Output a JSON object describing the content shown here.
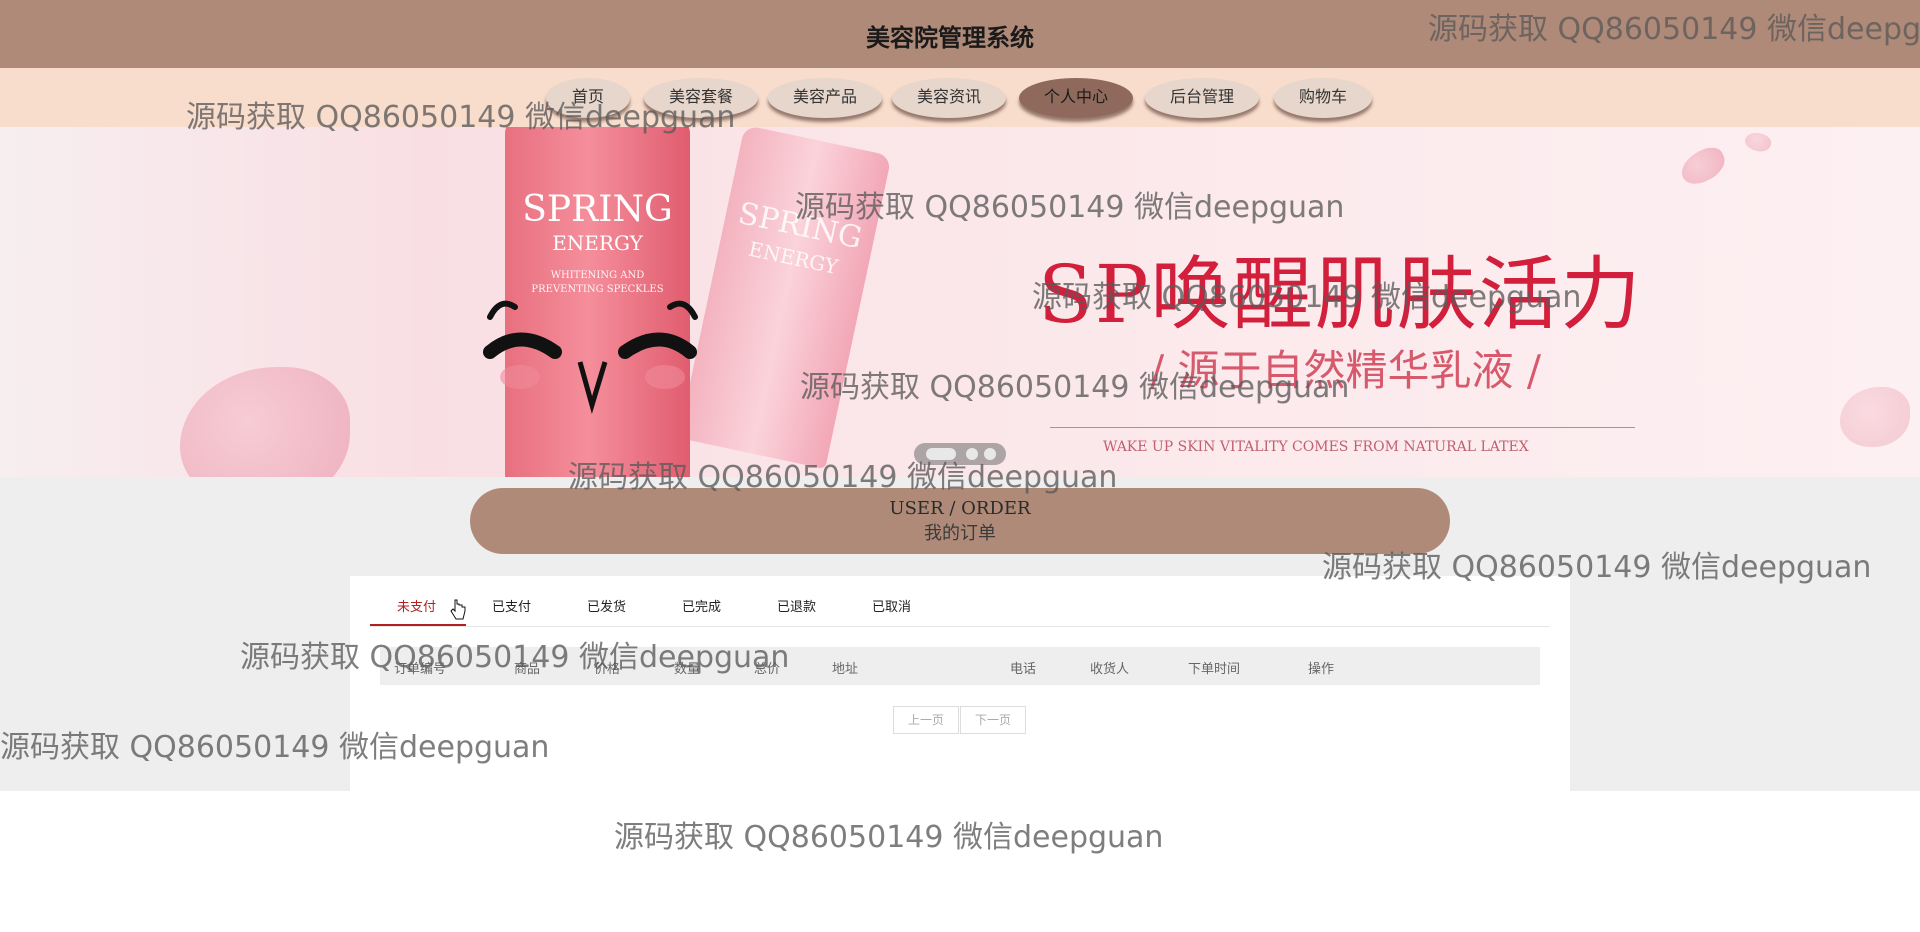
{
  "header": {
    "title": "美容院管理系统"
  },
  "nav": {
    "items": [
      {
        "label": "首页"
      },
      {
        "label": "美容套餐"
      },
      {
        "label": "美容产品"
      },
      {
        "label": "美容资讯"
      },
      {
        "label": "个人中心",
        "active": true
      },
      {
        "label": "后台管理"
      },
      {
        "label": "购物车"
      }
    ]
  },
  "banner": {
    "tube_brand": "SPRING",
    "tube_sub": "ENERGY",
    "tube_line": "WHITENING AND PREVENTING SPECKLES",
    "headline": "SP唤醒肌肤活力",
    "subline": "/ 源于自然精华乳液 /",
    "tagline": "WAKE UP SKIN VITALITY COMES FROM NATURAL LATEX",
    "slide_count": 3
  },
  "section": {
    "title_en": "USER / ORDER",
    "title_zh": "我的订单"
  },
  "order_tabs": [
    {
      "label": "未支付",
      "active": true
    },
    {
      "label": "已支付"
    },
    {
      "label": "已发货"
    },
    {
      "label": "已完成"
    },
    {
      "label": "已退款"
    },
    {
      "label": "已取消"
    }
  ],
  "table": {
    "columns": [
      "订单编号",
      "商品",
      "价格",
      "数量",
      "总价",
      "地址",
      "电话",
      "收货人",
      "下单时间",
      "操作"
    ],
    "rows": []
  },
  "pager": {
    "prev": "上一页",
    "next": "下一页"
  },
  "watermark": "源码获取 QQ86050149 微信deepguan",
  "colors": {
    "header": "#b08a78",
    "nav_bg": "#f8dccc",
    "active_tab": "#b32020",
    "page_gray": "#eeeeee"
  }
}
